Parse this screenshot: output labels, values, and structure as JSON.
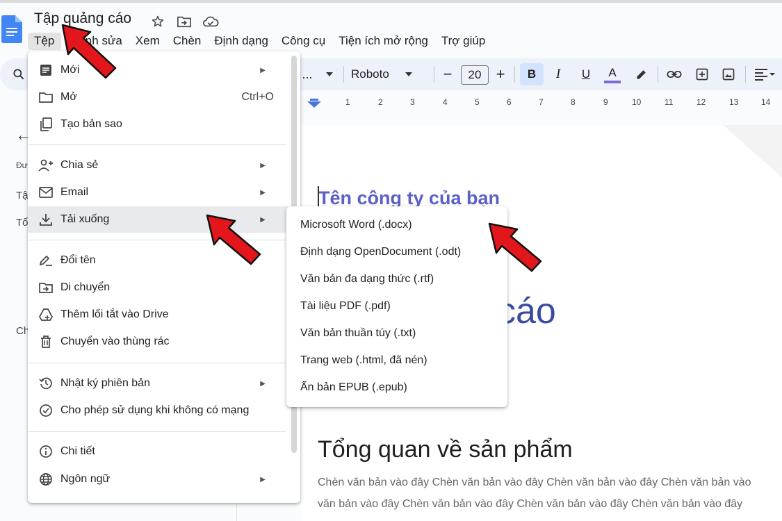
{
  "doc": {
    "title": "Tập quảng cáo"
  },
  "menubar": {
    "items": [
      "Tệp",
      "Chỉnh sửa",
      "Xem",
      "Chèn",
      "Định dạng",
      "Công cụ",
      "Tiện ích mở rộng",
      "Trợ giúp"
    ]
  },
  "toolbar": {
    "more": "...",
    "font": "Roboto",
    "font_size": "20",
    "minus": "−",
    "plus": "+",
    "bold": "B",
    "italic": "I",
    "underline": "U",
    "text_color_letter": "A",
    "text_color": "#7b6bd6"
  },
  "ruler": {
    "numbers": [
      "1",
      "2",
      "3",
      "4",
      "5",
      "6",
      "7",
      "8",
      "9",
      "10",
      "11",
      "12",
      "13",
      "14"
    ]
  },
  "sidebar": {
    "frag1": "Đư",
    "frag2": "Tậ",
    "frag3": "Tổ",
    "frag4": "Ch"
  },
  "file_menu": {
    "items": [
      {
        "label": "Mới",
        "icon": "new-doc-icon",
        "submenu": true
      },
      {
        "label": "Mở",
        "icon": "folder-icon",
        "shortcut": "Ctrl+O"
      },
      {
        "label": "Tạo bản sao",
        "icon": "copy-icon"
      },
      {
        "label": "Chia sẻ",
        "icon": "share-person-icon",
        "submenu": true
      },
      {
        "label": "Email",
        "icon": "mail-icon",
        "submenu": true
      },
      {
        "label": "Tải xuống",
        "icon": "download-icon",
        "submenu": true,
        "highlighted": true
      },
      {
        "label": "Đổi tên",
        "icon": "rename-icon"
      },
      {
        "label": "Di chuyển",
        "icon": "move-folder-icon"
      },
      {
        "label": "Thêm lối tắt vào Drive",
        "icon": "drive-shortcut-icon"
      },
      {
        "label": "Chuyển vào thùng rác",
        "icon": "trash-icon"
      },
      {
        "label": "Nhật ký phiên bản",
        "icon": "history-icon",
        "submenu": true
      },
      {
        "label": "Cho phép sử dụng khi không có mạng",
        "icon": "offline-icon"
      },
      {
        "label": "Chi tiết",
        "icon": "info-icon"
      },
      {
        "label": "Ngôn ngữ",
        "icon": "globe-icon",
        "submenu": true
      }
    ]
  },
  "download_submenu": {
    "items": [
      "Microsoft Word (.docx)",
      "Định dạng OpenDocument (.odt)",
      "Văn bản đa dạng thức (.rtf)",
      "Tài liệu PDF (.pdf)",
      "Văn bản thuần túy (.txt)",
      "Trang web (.html, đã nén)",
      "Ấn bản EPUB (.epub)"
    ]
  },
  "content": {
    "company_name": "Tên công ty của bạn",
    "big_word": "cáo",
    "heading": "Tổng quan về sản phẩm",
    "body_line1": "Chèn văn bản vào đây Chèn văn bản vào đây Chèn văn bản vào đây Chèn văn bản vào",
    "body_line2": "văn bản vào đây Chèn văn bản vào đây Chèn văn bản vào đây Chèn văn bản vào đây"
  },
  "colors": {
    "accent": "#d3e3fd",
    "annotation_arrow": "#e3171b"
  }
}
